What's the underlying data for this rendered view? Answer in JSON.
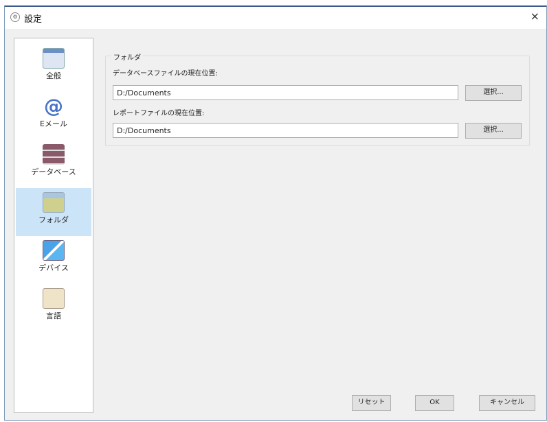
{
  "window": {
    "title": "設定",
    "icon": "settings-gear-icon",
    "close_icon": "close-icon",
    "close": "×"
  },
  "sidebar": {
    "items": [
      {
        "label": "全般",
        "icon": "general-settings-icon"
      },
      {
        "label": "Eメール",
        "icon": "at-sign-icon"
      },
      {
        "label": "データベース",
        "icon": "database-icon"
      },
      {
        "label": "フォルダ",
        "icon": "folder-icon",
        "selected": true
      },
      {
        "label": "デバイス",
        "icon": "network-devices-icon"
      },
      {
        "label": "言語",
        "icon": "language-icon"
      }
    ]
  },
  "folder": {
    "group_label": "フォルダ",
    "db_label": "データベースファイルの現在位置:",
    "db_value": "D:/Documents",
    "db_button": "選択...",
    "report_label": "レポートファイルの現在位置:",
    "report_value": "D:/Documents",
    "report_button": "選択..."
  },
  "buttons": {
    "reset": "リセット",
    "ok": "OK",
    "cancel": "キャンセル"
  }
}
